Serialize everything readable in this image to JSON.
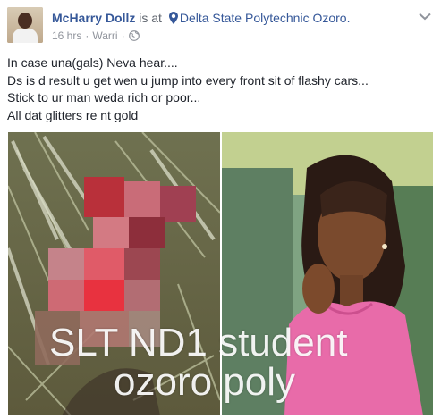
{
  "post": {
    "author": "McHarry Dollz",
    "is_at": "is at",
    "location": "Delta State Polytechnic Ozoro.",
    "time": "16 hrs",
    "separator": "·",
    "place_short": "Warri",
    "separator2": "·",
    "privacy_icon": "globe-icon",
    "options_icon": "chevron-down-icon",
    "lines": [
      "In case una(gals) Neva hear....",
      "Ds is d result u get wen u jump into every front sit of flashy cars...",
      "Stick to ur man weda rich or poor...",
      "All dat glitters re nt gold"
    ],
    "caption_line1": "SLT ND1 student",
    "caption_line2": "ozoro poly",
    "colors": {
      "link": "#365899",
      "text": "#1d2129",
      "meta": "#90949c"
    }
  }
}
